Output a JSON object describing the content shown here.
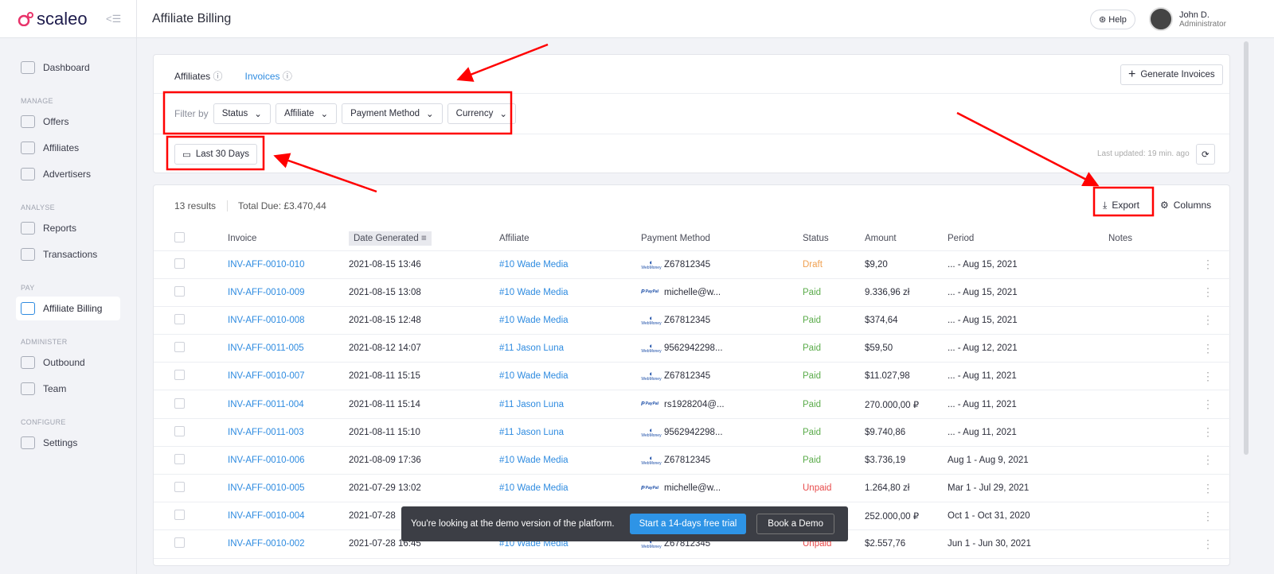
{
  "app": {
    "logo": "scaleo",
    "page_title": "Affiliate Billing",
    "help_label": "Help",
    "user_name": "John D.",
    "user_role": "Administrator"
  },
  "sidebar": {
    "dashboard": "Dashboard",
    "sections": [
      {
        "title": "MANAGE",
        "items": [
          "Offers",
          "Affiliates",
          "Advertisers"
        ]
      },
      {
        "title": "ANALYSE",
        "items": [
          "Reports",
          "Transactions"
        ]
      },
      {
        "title": "PAY",
        "items": [
          "Affiliate Billing"
        ]
      },
      {
        "title": "ADMINISTER",
        "items": [
          "Outbound",
          "Team"
        ]
      },
      {
        "title": "CONFIGURE",
        "items": [
          "Settings"
        ]
      }
    ],
    "active": "Affiliate Billing"
  },
  "tabs": [
    {
      "label": "Affiliates",
      "active": false
    },
    {
      "label": "Invoices",
      "active": true
    }
  ],
  "generate_label": "Generate Invoices",
  "filters": {
    "label": "Filter by",
    "items": [
      "Status",
      "Affiliate",
      "Payment Method",
      "Currency"
    ]
  },
  "date_range": "Last 30 Days",
  "last_updated": "Last updated: 19 min. ago",
  "summary": {
    "results": "13 results",
    "total_due": "Total Due: £3.470,44"
  },
  "export_label": "Export",
  "columns_label": "Columns",
  "columns": [
    "Invoice",
    "Date Generated",
    "Affiliate",
    "Payment Method",
    "Status",
    "Amount",
    "Period",
    "Notes"
  ],
  "rows": [
    {
      "invoice": "INV-AFF-0010-010",
      "date": "2021-08-15 13:46",
      "affiliate": "#10 Wade Media",
      "method": "WebMoney",
      "account": "Z67812345",
      "status": "Draft",
      "amount": "$9,20",
      "period": "... - Aug 15, 2021"
    },
    {
      "invoice": "INV-AFF-0010-009",
      "date": "2021-08-15 13:08",
      "affiliate": "#10 Wade Media",
      "method": "PayPal",
      "account": "michelle@w...",
      "status": "Paid",
      "amount": "9.336,96 zł",
      "period": "... - Aug 15, 2021"
    },
    {
      "invoice": "INV-AFF-0010-008",
      "date": "2021-08-15 12:48",
      "affiliate": "#10 Wade Media",
      "method": "WebMoney",
      "account": "Z67812345",
      "status": "Paid",
      "amount": "$374,64",
      "period": "... - Aug 15, 2021"
    },
    {
      "invoice": "INV-AFF-0011-005",
      "date": "2021-08-12 14:07",
      "affiliate": "#11 Jason Luna",
      "method": "WebMoney",
      "account": "9562942298...",
      "status": "Paid",
      "amount": "$59,50",
      "period": "... - Aug 12, 2021"
    },
    {
      "invoice": "INV-AFF-0010-007",
      "date": "2021-08-11 15:15",
      "affiliate": "#10 Wade Media",
      "method": "WebMoney",
      "account": "Z67812345",
      "status": "Paid",
      "amount": "$11.027,98",
      "period": "... - Aug 11, 2021"
    },
    {
      "invoice": "INV-AFF-0011-004",
      "date": "2021-08-11 15:14",
      "affiliate": "#11 Jason Luna",
      "method": "PayPal",
      "account": "rs1928204@...",
      "status": "Paid",
      "amount": "270.000,00 ₽",
      "period": "... - Aug 11, 2021"
    },
    {
      "invoice": "INV-AFF-0011-003",
      "date": "2021-08-11 15:10",
      "affiliate": "#11 Jason Luna",
      "method": "WebMoney",
      "account": "9562942298...",
      "status": "Paid",
      "amount": "$9.740,86",
      "period": "... - Aug 11, 2021"
    },
    {
      "invoice": "INV-AFF-0010-006",
      "date": "2021-08-09 17:36",
      "affiliate": "#10 Wade Media",
      "method": "WebMoney",
      "account": "Z67812345",
      "status": "Paid",
      "amount": "$3.736,19",
      "period": "Aug 1 - Aug 9, 2021"
    },
    {
      "invoice": "INV-AFF-0010-005",
      "date": "2021-07-29 13:02",
      "affiliate": "#10 Wade Media",
      "method": "PayPal",
      "account": "michelle@w...",
      "status": "Unpaid",
      "amount": "1.264,80 zł",
      "period": "Mar 1 - Jul 29, 2021"
    },
    {
      "invoice": "INV-AFF-0010-004",
      "date": "2021-07-28",
      "affiliate": "",
      "method": "",
      "account": "",
      "status": "",
      "amount": "252.000,00 ₽",
      "period": "Oct 1 - Oct 31, 2020"
    },
    {
      "invoice": "INV-AFF-0010-002",
      "date": "2021-07-28 16:45",
      "affiliate": "#10 Wade Media",
      "method": "WebMoney",
      "account": "Z67812345",
      "status": "Unpaid",
      "amount": "$2.557,76",
      "period": "Jun 1 - Jun 30, 2021"
    }
  ],
  "banner": {
    "text": "You're looking at the demo version of the platform.",
    "trial": "Start a 14-days free trial",
    "demo": "Book a Demo"
  },
  "colors": {
    "accent": "#2e8be0",
    "annotation": "#ff0000",
    "draft": "#f0a050",
    "paid": "#5aab4a",
    "unpaid": "#e84b4b"
  }
}
